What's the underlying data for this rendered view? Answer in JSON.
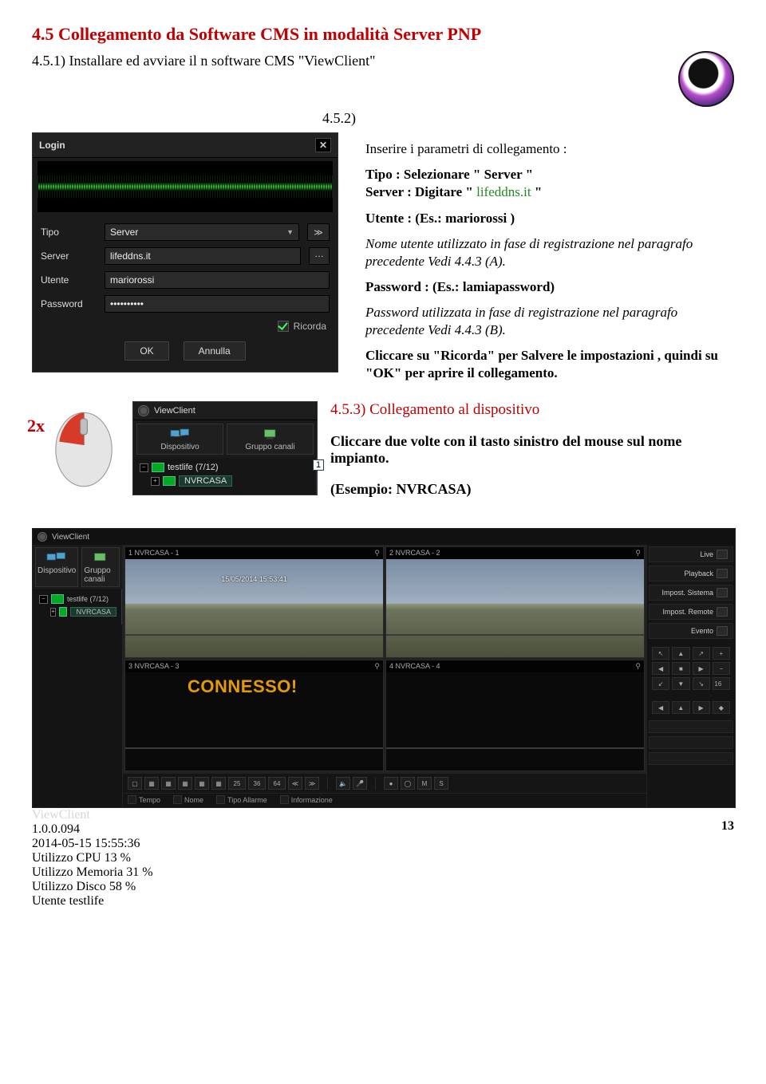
{
  "section_title": "4.5 Collegamento da Software CMS in modalità Server PNP",
  "step451": "4.5.1) Installare ed avviare il n software CMS \"ViewClient\"",
  "step452": "4.5.2)",
  "step452_rest": "Inserire i parametri di collegamento :",
  "login": {
    "title": "Login",
    "tipo_label": "Tipo",
    "tipo_value": "Server",
    "server_label": "Server",
    "server_value": "lifeddns.it",
    "utente_label": "Utente",
    "utente_value": "mariorossi",
    "password_label": "Password",
    "password_value": "••••••••••",
    "ricorda": "Ricorda",
    "ok": "OK",
    "annulla": "Annulla"
  },
  "instr": {
    "tipo_full": "Tipo : Selezionare \" Server \"",
    "server_full_a": "Server : Digitare \" ",
    "server_link": "lifeddns.it",
    "server_full_b": " \"",
    "utente_full": "Utente : (Es.: mariorossi )",
    "utente_note": "Nome utente utilizzato in fase di registrazione nel paragrafo precedente Vedi 4.4.3 (A).",
    "password_full": "Password : (Es.: lamiapassword)",
    "password_note": "Password utilizzata in fase di registrazione nel paragrafo precedente Vedi 4.4.3 (B).",
    "ricorda_note": "Cliccare su \"Ricorda\" per Salvere le impostazioni , quindi su \"OK\" per aprire il collegamento."
  },
  "twox": "2x",
  "tree": {
    "app": "ViewClient",
    "tab1": "Dispositivo",
    "tab2": "Gruppo canali",
    "node1": "testlife (7/12)",
    "node2": "NVRCASA",
    "side_num": "1"
  },
  "connect": {
    "h": "4.5.3) Collegamento al dispositivo",
    "l1": "Cliccare due volte con il tasto sinistro del mouse sul nome impianto.",
    "l2": "(Esempio: NVRCASA)"
  },
  "vc": {
    "app": "ViewClient",
    "left_tab1": "Dispositivo",
    "left_tab2": "Gruppo canali",
    "left_node1": "testlife (7/12)",
    "left_node2": "NVRCASA",
    "cells": [
      {
        "t": "1 NVRCASA - 1",
        "osd": "15/05/2014 15:53:41"
      },
      {
        "t": "2 NVRCASA - 2",
        "osd": ""
      },
      {
        "t": "3 NVRCASA - 3",
        "osd": ""
      },
      {
        "t": "4 NVRCASA - 4",
        "osd": ""
      }
    ],
    "connesso": "CONNESSO!",
    "right": {
      "live": "Live",
      "playback": "Playback",
      "imp_sistema": "Impost. Sistema",
      "imp_remote": "Impost. Remote",
      "evento": "Evento",
      "sixteen": "16"
    },
    "status": {
      "tempo": "Tempo",
      "nome": "Nome",
      "tipo_allarme": "Tipo Allarme",
      "informazione": "Informazione"
    },
    "footer": {
      "app": "ViewClient",
      "ver": "1.0.0.094",
      "dt": "2014-05-15 15:55:36",
      "cpu": "Utilizzo CPU      13 %",
      "mem": "Utilizzo Memoria  31 %",
      "disk": "Utilizzo Disco    58 %",
      "user": "Utente testlife"
    },
    "tb": {
      "n25": "25",
      "n36": "36",
      "n64": "64",
      "m": "M",
      "s": "S"
    }
  },
  "page_no": "13"
}
